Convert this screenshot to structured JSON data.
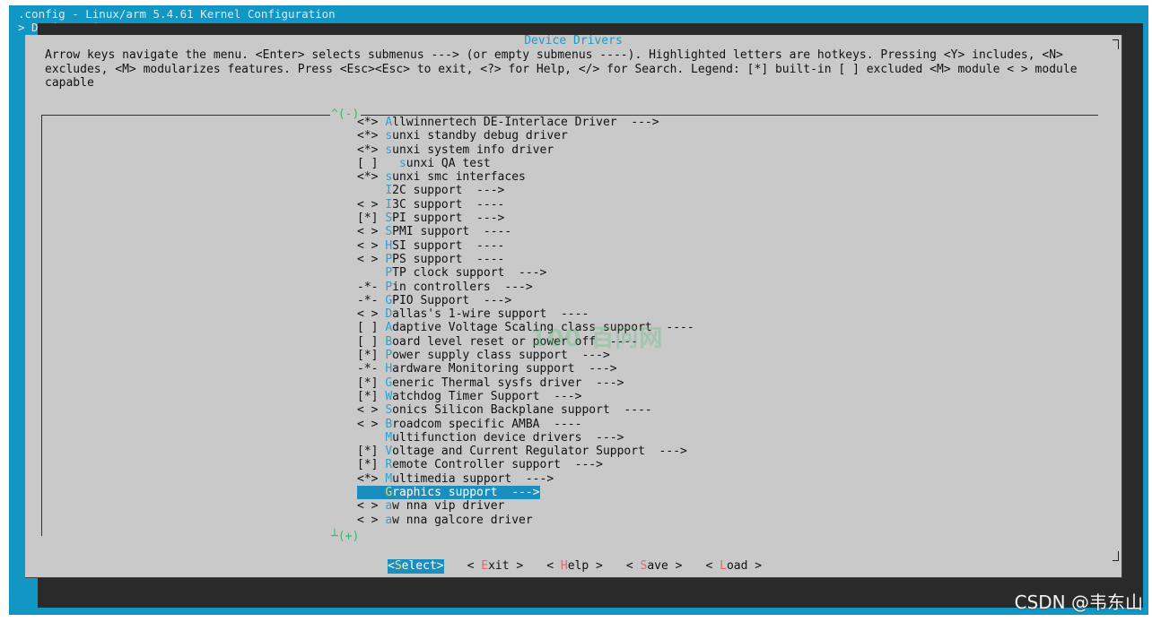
{
  "window": {
    "title": ".config - Linux/arm 5.4.61 Kernel Configuration",
    "breadcrumb": "> Device Drivers"
  },
  "dialog": {
    "title": "Device Drivers",
    "help": "Arrow keys navigate the menu.  <Enter> selects submenus ---> (or empty submenus ----).  Highlighted letters are hotkeys.  Pressing <Y> includes, <N> excludes, <M> modularizes features.  Press <Esc><Esc> to exit, <?> for Help, </> for Search.  Legend: [*] built-in  [ ] excluded  <M> module  < > module capable",
    "scroll_up": "^(-)",
    "scroll_down": "┴(+)"
  },
  "menu": {
    "items": [
      {
        "prefix": "<*> ",
        "hotkey": "A",
        "rest": "llwinnertech DE-Interlace Driver  --->"
      },
      {
        "prefix": "<*> ",
        "hotkey": "s",
        "rest": "unxi standby debug driver"
      },
      {
        "prefix": "<*> ",
        "hotkey": "s",
        "rest": "unxi system info driver"
      },
      {
        "prefix": "[ ]   ",
        "hotkey": "s",
        "rest": "unxi QA test"
      },
      {
        "prefix": "<*> ",
        "hotkey": "s",
        "rest": "unxi smc interfaces"
      },
      {
        "prefix": "    ",
        "hotkey": "I",
        "rest": "2C support  --->"
      },
      {
        "prefix": "< > ",
        "hotkey": "I",
        "rest": "3C support  ----"
      },
      {
        "prefix": "[*] ",
        "hotkey": "S",
        "rest": "PI support  --->"
      },
      {
        "prefix": "< > ",
        "hotkey": "S",
        "rest": "PMI support  ----"
      },
      {
        "prefix": "< > ",
        "hotkey": "H",
        "rest": "SI support  ----"
      },
      {
        "prefix": "< > ",
        "hotkey": "P",
        "rest": "PS support  ----"
      },
      {
        "prefix": "    ",
        "hotkey": "P",
        "rest": "TP clock support  --->"
      },
      {
        "prefix": "-*- ",
        "hotkey": "P",
        "rest": "in controllers  --->"
      },
      {
        "prefix": "-*- ",
        "hotkey": "G",
        "rest": "PIO Support  --->"
      },
      {
        "prefix": "< > ",
        "hotkey": "D",
        "rest": "allas's 1-wire support  ----"
      },
      {
        "prefix": "[ ] ",
        "hotkey": "A",
        "rest": "daptive Voltage Scaling class support  ----"
      },
      {
        "prefix": "[ ] ",
        "hotkey": "B",
        "rest": "oard level reset or power off  ----"
      },
      {
        "prefix": "[*] ",
        "hotkey": "P",
        "rest": "ower supply class support  --->"
      },
      {
        "prefix": "-*- ",
        "hotkey": "H",
        "rest": "ardware Monitoring support  --->"
      },
      {
        "prefix": "[*] ",
        "hotkey": "G",
        "rest": "eneric Thermal sysfs driver  --->"
      },
      {
        "prefix": "[*] ",
        "hotkey": "W",
        "rest": "atchdog Timer Support  --->"
      },
      {
        "prefix": "< > ",
        "hotkey": "S",
        "rest": "onics Silicon Backplane support  ----"
      },
      {
        "prefix": "< > ",
        "hotkey": "B",
        "rest": "roadcom specific AMBA  ----"
      },
      {
        "prefix": "    ",
        "hotkey": "M",
        "rest": "ultifunction device drivers  --->"
      },
      {
        "prefix": "[*] ",
        "hotkey": "V",
        "rest": "oltage and Current Regulator Support  --->"
      },
      {
        "prefix": "[*] ",
        "hotkey": "R",
        "rest": "emote Controller support  --->"
      },
      {
        "prefix": "<*> ",
        "hotkey": "M",
        "rest": "ultimedia support  --->"
      },
      {
        "prefix": "    ",
        "hotkey": "G",
        "rest": "raphics support  --->",
        "selected": true
      },
      {
        "prefix": "< > ",
        "hotkey": "a",
        "rest": "w nna vip driver"
      },
      {
        "prefix": "< > ",
        "hotkey": "a",
        "rest": "w nna galcore driver"
      }
    ]
  },
  "buttons": [
    {
      "open": "<",
      "hotkey": "S",
      "rest": "elect",
      "close": ">",
      "active": true
    },
    {
      "open": "< ",
      "hotkey": "E",
      "rest": "xit",
      "close": " >",
      "active": false
    },
    {
      "open": "< ",
      "hotkey": "H",
      "rest": "elp",
      "close": " >",
      "active": false
    },
    {
      "open": "< ",
      "hotkey": "S",
      "rest": "ave",
      "close": " >",
      "active": false
    },
    {
      "open": "< ",
      "hotkey": "L",
      "rest": "oad",
      "close": " >",
      "active": false
    }
  ],
  "watermark": "100 百问网",
  "credit": "CSDN @韦东山",
  "colors": {
    "background": "#1296c4",
    "dialog": "#c9c9c9",
    "hotkey": "#2ea0d0",
    "selection": "#1a8fbf",
    "button_hotkey": "#e06a6a",
    "scroll_indicator": "#3cb86b"
  }
}
